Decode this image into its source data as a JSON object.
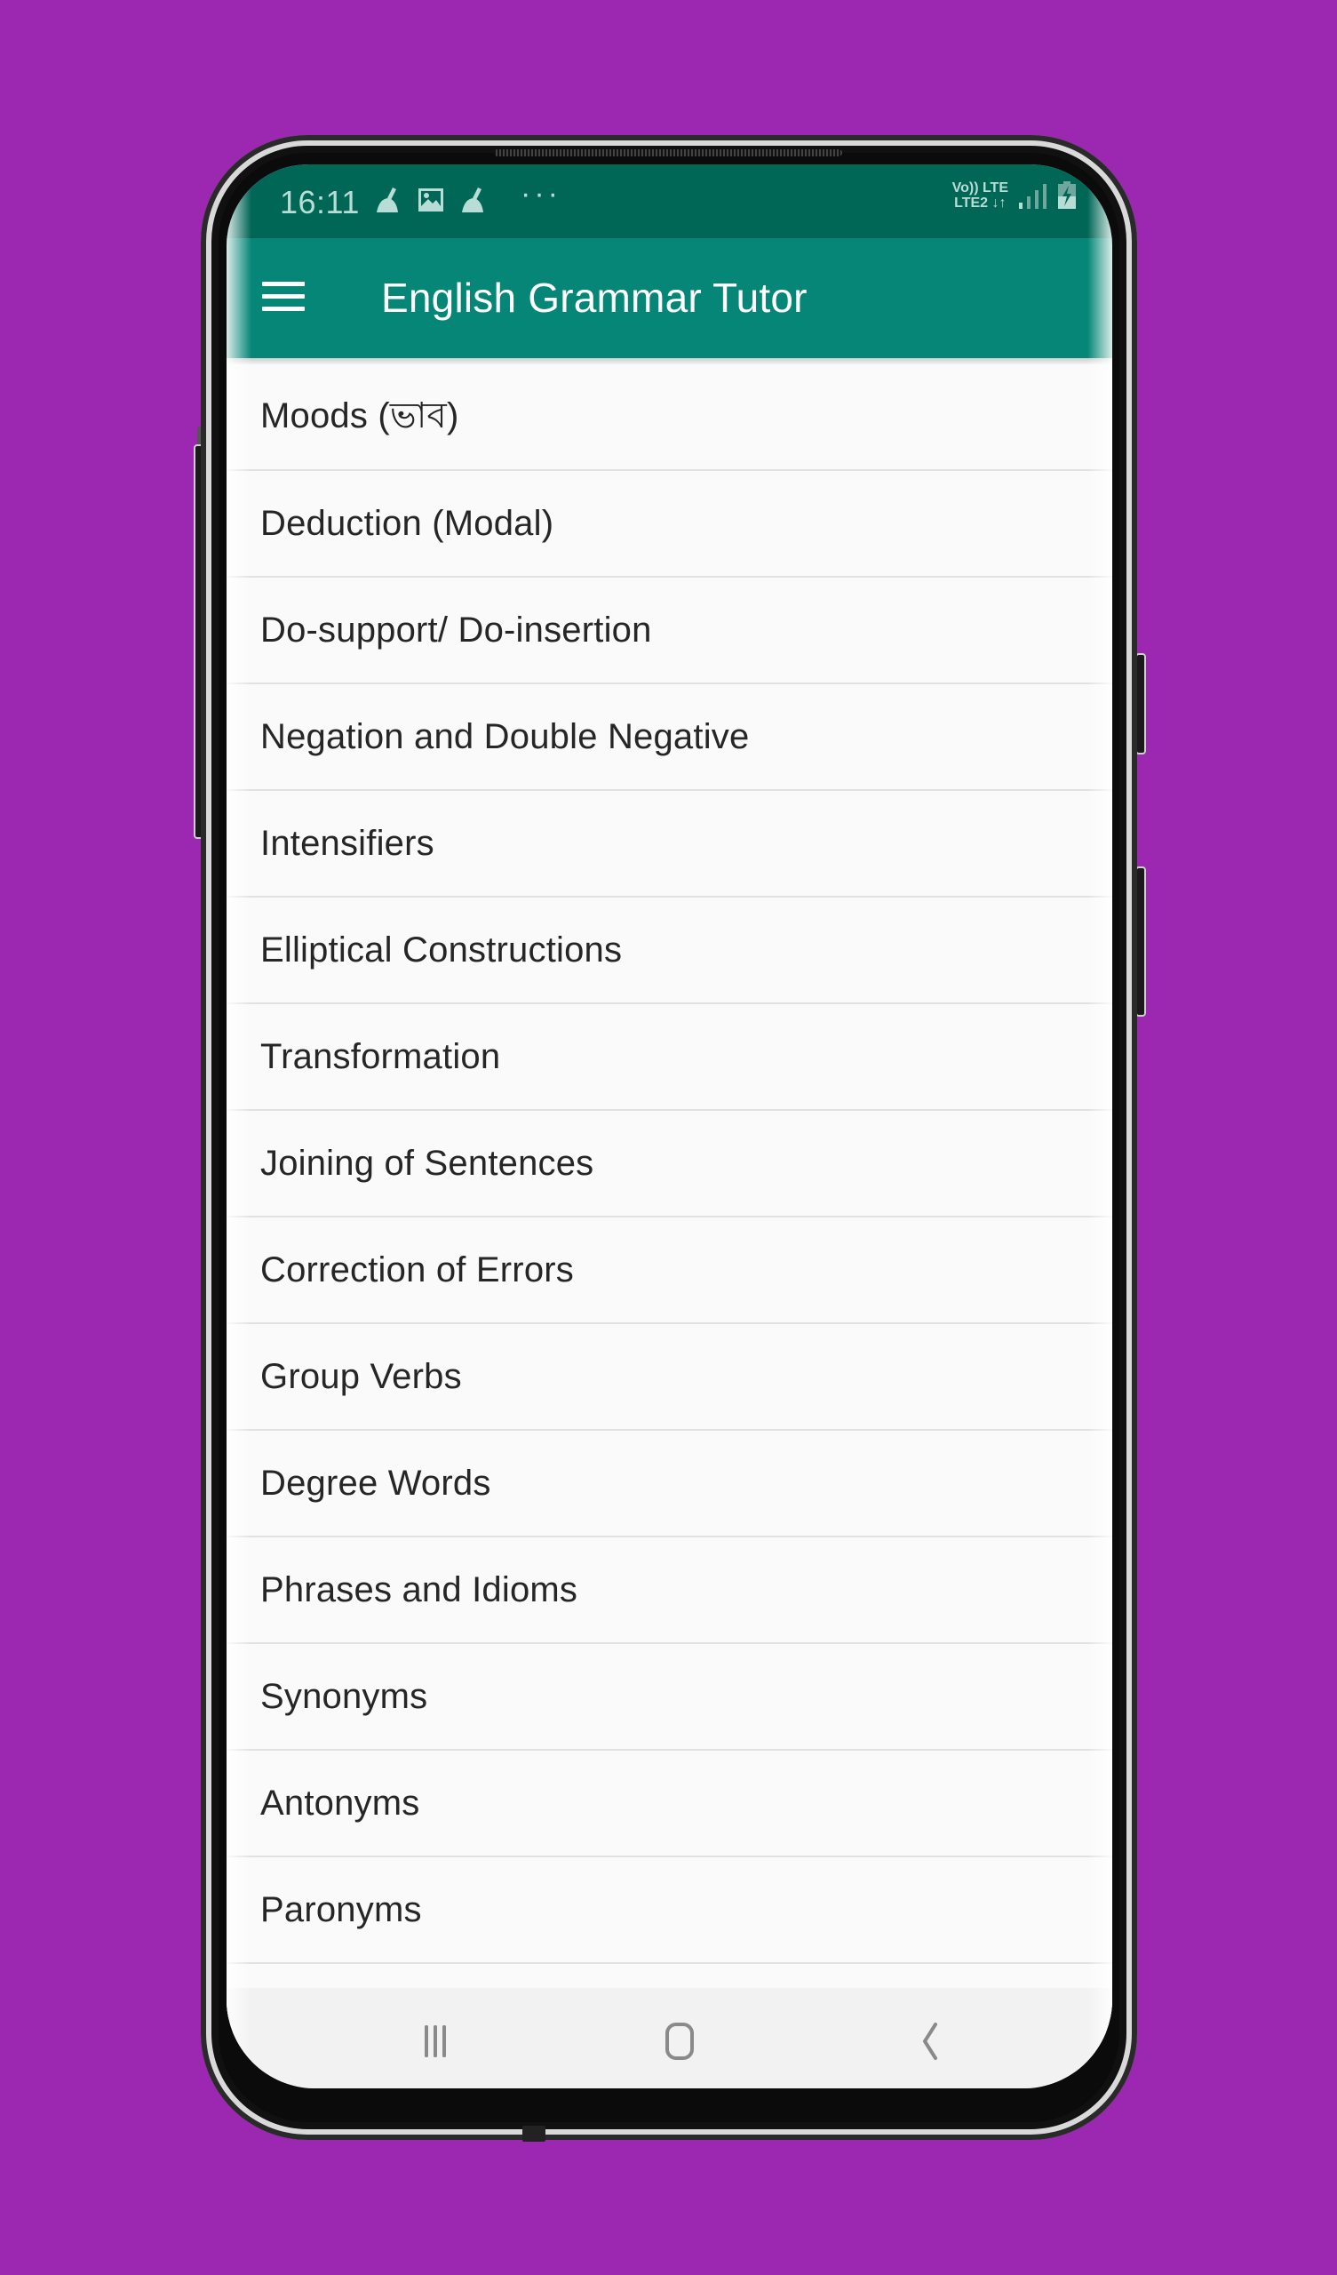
{
  "status_bar": {
    "time": "16:11",
    "left_icons": [
      "cleaner-broom-icon",
      "gallery-image-icon",
      "cleaner-broom-icon",
      "more-dots-icon"
    ],
    "more_indicator": "···",
    "network_line1": "Vo)) LTE",
    "network_line2": "LTE2 ↓↑",
    "signal_bars": "signal-icon",
    "battery": "battery-charging-icon"
  },
  "app_bar": {
    "title": "English Grammar Tutor",
    "menu_icon": "hamburger-menu-icon"
  },
  "topics": [
    "Moods (ভাব)",
    "Deduction (Modal)",
    "Do-support/ Do-insertion",
    "Negation and Double Negative",
    "Intensifiers",
    "Elliptical Constructions",
    "Transformation",
    "Joining of Sentences",
    "Correction of Errors",
    "Group Verbs",
    "Degree Words",
    "Phrases and Idioms",
    "Synonyms",
    "Antonyms",
    "Paronyms"
  ],
  "nav_bar": {
    "recents": "recents-icon",
    "home": "home-icon",
    "back": "back-icon"
  },
  "colors": {
    "background": "#9c27b0",
    "status_bar": "#006656",
    "app_bar": "#058677",
    "list_bg": "#fafafa",
    "divider": "#e1e1e1",
    "nav_bar": "#f2f2f2"
  }
}
